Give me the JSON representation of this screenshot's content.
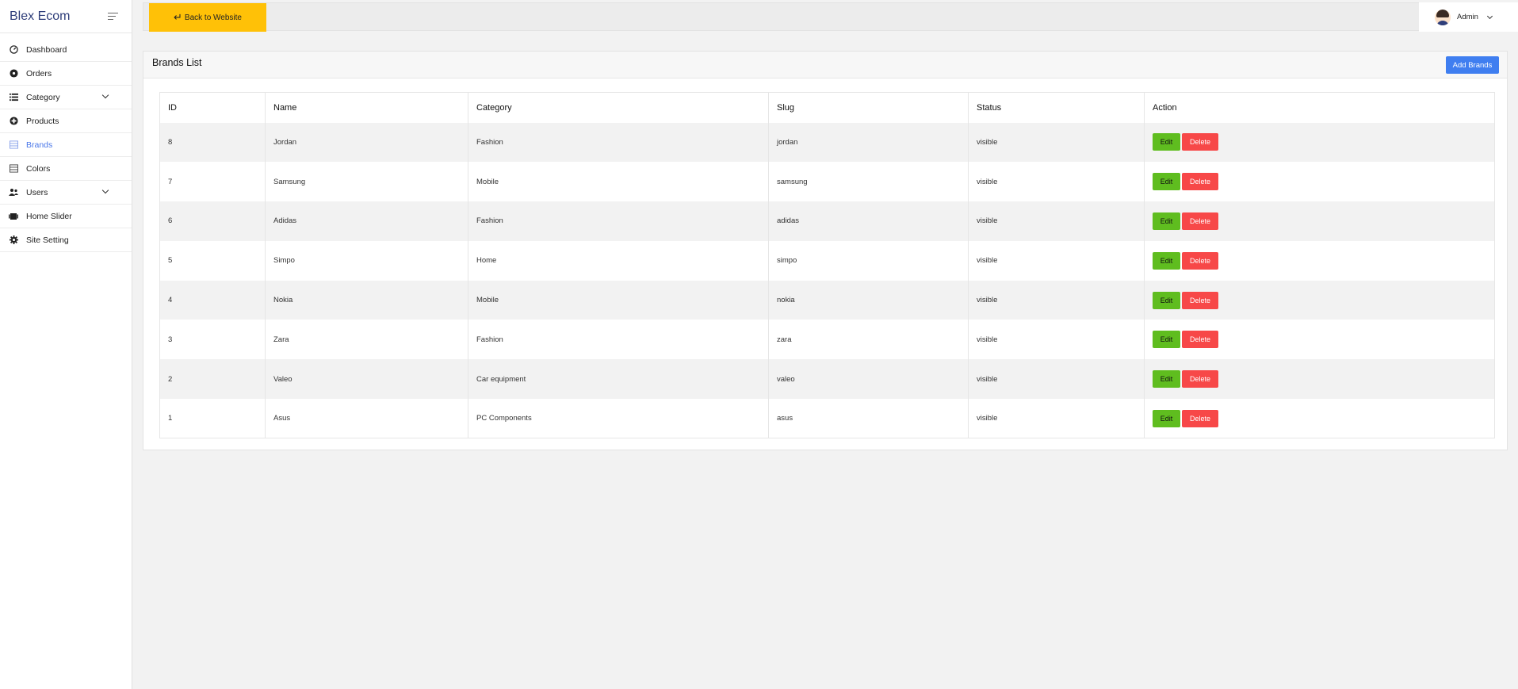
{
  "app": {
    "title": "Blex Ecom"
  },
  "sidebar": {
    "items": [
      {
        "label": "Dashboard",
        "icon": "gauge-icon"
      },
      {
        "label": "Orders",
        "icon": "settings-icon"
      },
      {
        "label": "Category",
        "icon": "list-icon",
        "has_children": true
      },
      {
        "label": "Products",
        "icon": "plus-circle-icon"
      },
      {
        "label": "Brands",
        "icon": "table-icon",
        "active": true
      },
      {
        "label": "Colors",
        "icon": "table-icon"
      },
      {
        "label": "Users",
        "icon": "users-icon",
        "has_children": true
      },
      {
        "label": "Home Slider",
        "icon": "film-icon"
      },
      {
        "label": "Site Setting",
        "icon": "gear-icon"
      }
    ]
  },
  "header": {
    "back_label": "Back to Website",
    "user_name": "Admin"
  },
  "card": {
    "title": "Brands List",
    "add_label": "Add Brands"
  },
  "table": {
    "columns": [
      "ID",
      "Name",
      "Category",
      "Slug",
      "Status",
      "Action"
    ],
    "edit_label": "Edit",
    "delete_label": "Delete",
    "rows": [
      {
        "id": "8",
        "name": "Jordan",
        "category": "Fashion",
        "slug": "jordan",
        "status": "visible"
      },
      {
        "id": "7",
        "name": "Samsung",
        "category": "Mobile",
        "slug": "samsung",
        "status": "visible"
      },
      {
        "id": "6",
        "name": "Adidas",
        "category": "Fashion",
        "slug": "adidas",
        "status": "visible"
      },
      {
        "id": "5",
        "name": "Simpo",
        "category": "Home",
        "slug": "simpo",
        "status": "visible"
      },
      {
        "id": "4",
        "name": "Nokia",
        "category": "Mobile",
        "slug": "nokia",
        "status": "visible"
      },
      {
        "id": "3",
        "name": "Zara",
        "category": "Fashion",
        "slug": "zara",
        "status": "visible"
      },
      {
        "id": "2",
        "name": "Valeo",
        "category": "Car equipment",
        "slug": "valeo",
        "status": "visible"
      },
      {
        "id": "1",
        "name": "Asus",
        "category": "PC Components",
        "slug": "asus",
        "status": "visible"
      }
    ]
  },
  "colors": {
    "back_button": "#ffc107",
    "add_button": "#3f7ef0",
    "edit_button": "#5fbd1f",
    "delete_button": "#f74848",
    "active_nav": "#4a77e8"
  }
}
